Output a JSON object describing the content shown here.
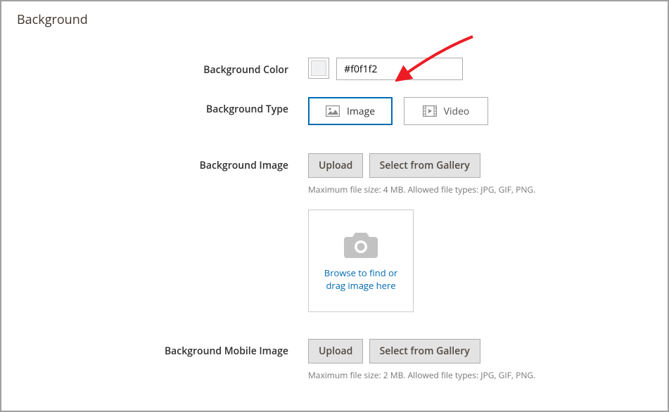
{
  "panel_title": "Background",
  "labels": {
    "color": "Background Color",
    "type": "Background Type",
    "image": "Background Image",
    "mobile": "Background Mobile Image"
  },
  "color_value": "#f0f1f2",
  "type_options": {
    "image": "Image",
    "video": "Video"
  },
  "buttons": {
    "upload": "Upload",
    "gallery": "Select from Gallery"
  },
  "hints": {
    "image": "Maximum file size: 4 MB. Allowed file types: JPG, GIF, PNG.",
    "mobile": "Maximum file size: 2 MB. Allowed file types: JPG, GIF, PNG."
  },
  "dropzone_text": "Browse to find or drag image here"
}
